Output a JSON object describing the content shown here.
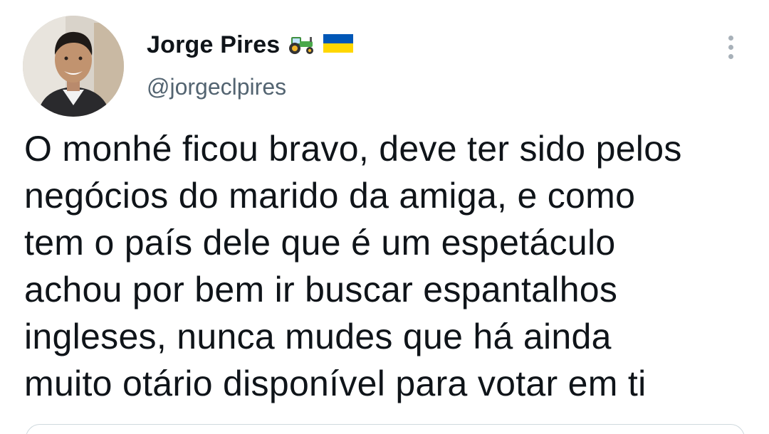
{
  "author": {
    "display_name": "Jorge Pires",
    "handle": "@jorgeclpires",
    "name_icons": [
      "tractor-icon",
      "ukraine-flag-icon"
    ]
  },
  "menu": {
    "icon": "more-vertical-icon"
  },
  "tweet": {
    "text": "O monhé ficou bravo, deve ter sido pelos\nnegócios do marido da amiga,  e como\ntem o país dele que é um espetáculo\nachou por bem ir buscar espantalhos\ningleses, nunca mudes que há ainda\nmuito otário disponível para votar em ti"
  },
  "colors": {
    "text": "#0f1419",
    "secondary_text": "#536471",
    "border": "#cfd9de",
    "flag_blue": "#0057b7",
    "flag_yellow": "#ffd700"
  }
}
